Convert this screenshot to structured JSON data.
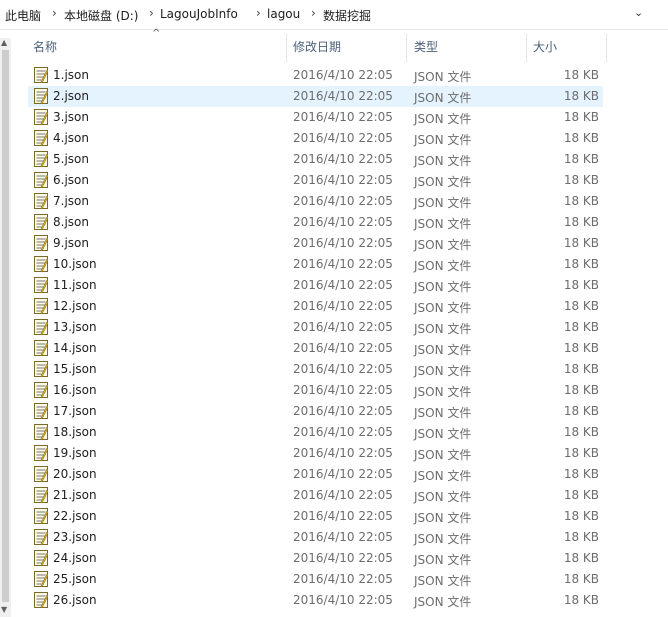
{
  "breadcrumb": [
    "此电脑",
    "本地磁盘 (D:)",
    "LagouJobInfo",
    "lagou",
    "数据挖掘"
  ],
  "icons": {
    "breadcrumb_separator": "chevron-right-icon",
    "address_dropdown": "chevron-down-icon",
    "sort_indicator": "sort-ascending-icon",
    "file": "json-file-icon"
  },
  "columns": {
    "name": "名称",
    "date": "修改日期",
    "type": "类型",
    "size": "大小"
  },
  "selected_file": "2.json",
  "files": [
    {
      "name": "1.json",
      "date": "2016/4/10 22:05",
      "type": "JSON 文件",
      "size": "18 KB"
    },
    {
      "name": "2.json",
      "date": "2016/4/10 22:05",
      "type": "JSON 文件",
      "size": "18 KB"
    },
    {
      "name": "3.json",
      "date": "2016/4/10 22:05",
      "type": "JSON 文件",
      "size": "18 KB"
    },
    {
      "name": "4.json",
      "date": "2016/4/10 22:05",
      "type": "JSON 文件",
      "size": "18 KB"
    },
    {
      "name": "5.json",
      "date": "2016/4/10 22:05",
      "type": "JSON 文件",
      "size": "18 KB"
    },
    {
      "name": "6.json",
      "date": "2016/4/10 22:05",
      "type": "JSON 文件",
      "size": "18 KB"
    },
    {
      "name": "7.json",
      "date": "2016/4/10 22:05",
      "type": "JSON 文件",
      "size": "18 KB"
    },
    {
      "name": "8.json",
      "date": "2016/4/10 22:05",
      "type": "JSON 文件",
      "size": "18 KB"
    },
    {
      "name": "9.json",
      "date": "2016/4/10 22:05",
      "type": "JSON 文件",
      "size": "18 KB"
    },
    {
      "name": "10.json",
      "date": "2016/4/10 22:05",
      "type": "JSON 文件",
      "size": "18 KB"
    },
    {
      "name": "11.json",
      "date": "2016/4/10 22:05",
      "type": "JSON 文件",
      "size": "18 KB"
    },
    {
      "name": "12.json",
      "date": "2016/4/10 22:05",
      "type": "JSON 文件",
      "size": "18 KB"
    },
    {
      "name": "13.json",
      "date": "2016/4/10 22:05",
      "type": "JSON 文件",
      "size": "18 KB"
    },
    {
      "name": "14.json",
      "date": "2016/4/10 22:05",
      "type": "JSON 文件",
      "size": "18 KB"
    },
    {
      "name": "15.json",
      "date": "2016/4/10 22:05",
      "type": "JSON 文件",
      "size": "18 KB"
    },
    {
      "name": "16.json",
      "date": "2016/4/10 22:05",
      "type": "JSON 文件",
      "size": "18 KB"
    },
    {
      "name": "17.json",
      "date": "2016/4/10 22:05",
      "type": "JSON 文件",
      "size": "18 KB"
    },
    {
      "name": "18.json",
      "date": "2016/4/10 22:05",
      "type": "JSON 文件",
      "size": "18 KB"
    },
    {
      "name": "19.json",
      "date": "2016/4/10 22:05",
      "type": "JSON 文件",
      "size": "18 KB"
    },
    {
      "name": "20.json",
      "date": "2016/4/10 22:05",
      "type": "JSON 文件",
      "size": "18 KB"
    },
    {
      "name": "21.json",
      "date": "2016/4/10 22:05",
      "type": "JSON 文件",
      "size": "18 KB"
    },
    {
      "name": "22.json",
      "date": "2016/4/10 22:05",
      "type": "JSON 文件",
      "size": "18 KB"
    },
    {
      "name": "23.json",
      "date": "2016/4/10 22:05",
      "type": "JSON 文件",
      "size": "18 KB"
    },
    {
      "name": "24.json",
      "date": "2016/4/10 22:05",
      "type": "JSON 文件",
      "size": "18 KB"
    },
    {
      "name": "25.json",
      "date": "2016/4/10 22:05",
      "type": "JSON 文件",
      "size": "18 KB"
    },
    {
      "name": "26.json",
      "date": "2016/4/10 22:05",
      "type": "JSON 文件",
      "size": "18 KB"
    }
  ]
}
